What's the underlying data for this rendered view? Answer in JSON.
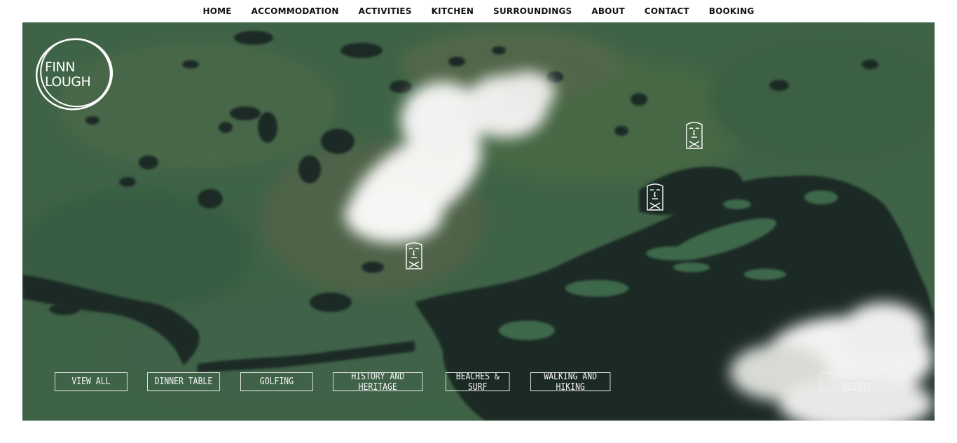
{
  "nav": {
    "items": [
      {
        "label": "HOME"
      },
      {
        "label": "ACCOMMODATION"
      },
      {
        "label": "ACTIVITIES"
      },
      {
        "label": "KITCHEN"
      },
      {
        "label": "SURROUNDINGS"
      },
      {
        "label": "ABOUT"
      },
      {
        "label": "CONTACT"
      },
      {
        "label": "BOOKING"
      }
    ]
  },
  "logo": {
    "line1": "FINN",
    "line2": "LOUGH"
  },
  "filters": {
    "view_all": "VIEW ALL",
    "dinner_table": "DINNER TABLE",
    "golfing": "GOLFING",
    "history": "HISTORY AND HERITAGE",
    "beaches": "BEACHES & SURF",
    "walking": "WALKING AND HIKING",
    "back": "BACK TO RESORT"
  },
  "colors": {
    "land": "#3f6346",
    "water": "#1b2a26",
    "cloud": "#f4f4f2",
    "outline": "#f2f2f2"
  },
  "icons": [
    "map-marker-face-icon"
  ]
}
